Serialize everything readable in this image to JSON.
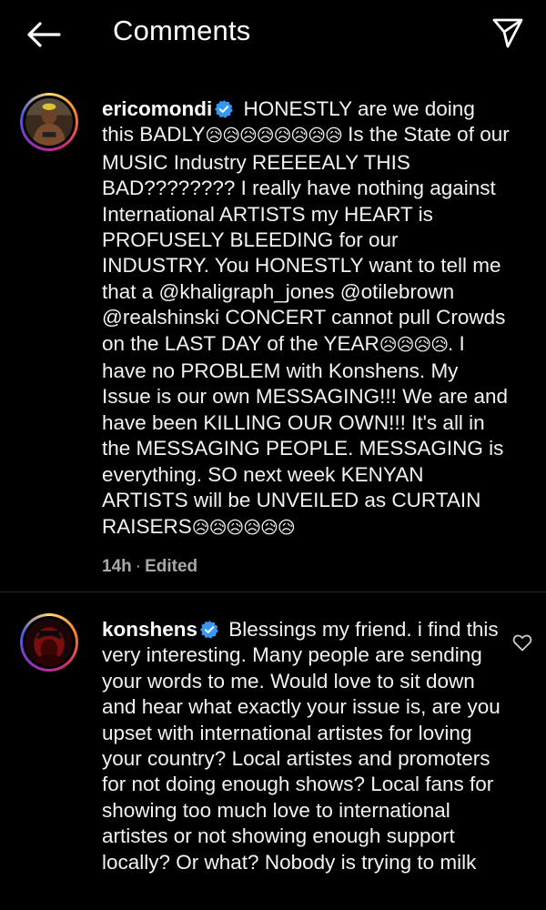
{
  "header": {
    "title": "Comments"
  },
  "comments": [
    {
      "username": "ericomondi",
      "verified": true,
      "segments": [
        {
          "t": "HONESTLY are we doing this BADLY",
          "k": "text"
        },
        {
          "t": "😥😥😥😥😥😥😥😥",
          "k": "emoji"
        },
        {
          "t": " Is the State of our MUSIC Industry REEEEALY THIS BAD???????? I really have nothing against International ARTISTS my HEART is PROFUSELY BLEEDING for our INDUSTRY.  You HONESTLY want to tell me that a ",
          "k": "text"
        },
        {
          "t": "@khaligraph_jones",
          "k": "mention"
        },
        {
          "t": " ",
          "k": "text"
        },
        {
          "t": "@otilebrown",
          "k": "mention"
        },
        {
          "t": " ",
          "k": "text"
        },
        {
          "t": "@realshinski",
          "k": "mention"
        },
        {
          "t": " CONCERT cannot pull Crowds on the LAST DAY of the YEAR",
          "k": "text"
        },
        {
          "t": "😥😥😥😥",
          "k": "emoji"
        },
        {
          "t": ". I have no PROBLEM with Konshens. My Issue is our own MESSAGING!!! We are and have been KILLING OUR OWN!!! It's all in the MESSAGING PEOPLE. MESSAGING is everything. SO next week KENYAN ARTISTS will be UNVEILED as CURTAIN RAISERS",
          "k": "text"
        },
        {
          "t": "😥😥😥😥😥😥",
          "k": "emoji"
        }
      ],
      "time": "14h",
      "edited": "Edited"
    },
    {
      "username": "konshens",
      "verified": true,
      "segments": [
        {
          "t": "Blessings my friend. i find this very interesting. Many people are sending your words to me. Would love to sit down and hear what exactly your issue is, are you upset with international artistes for loving your country? Local artistes and promoters for not doing enough shows? Local fans for showing too much love to international artistes or not showing enough support locally? Or what?  Nobody is trying to milk",
          "k": "text"
        }
      ]
    }
  ]
}
